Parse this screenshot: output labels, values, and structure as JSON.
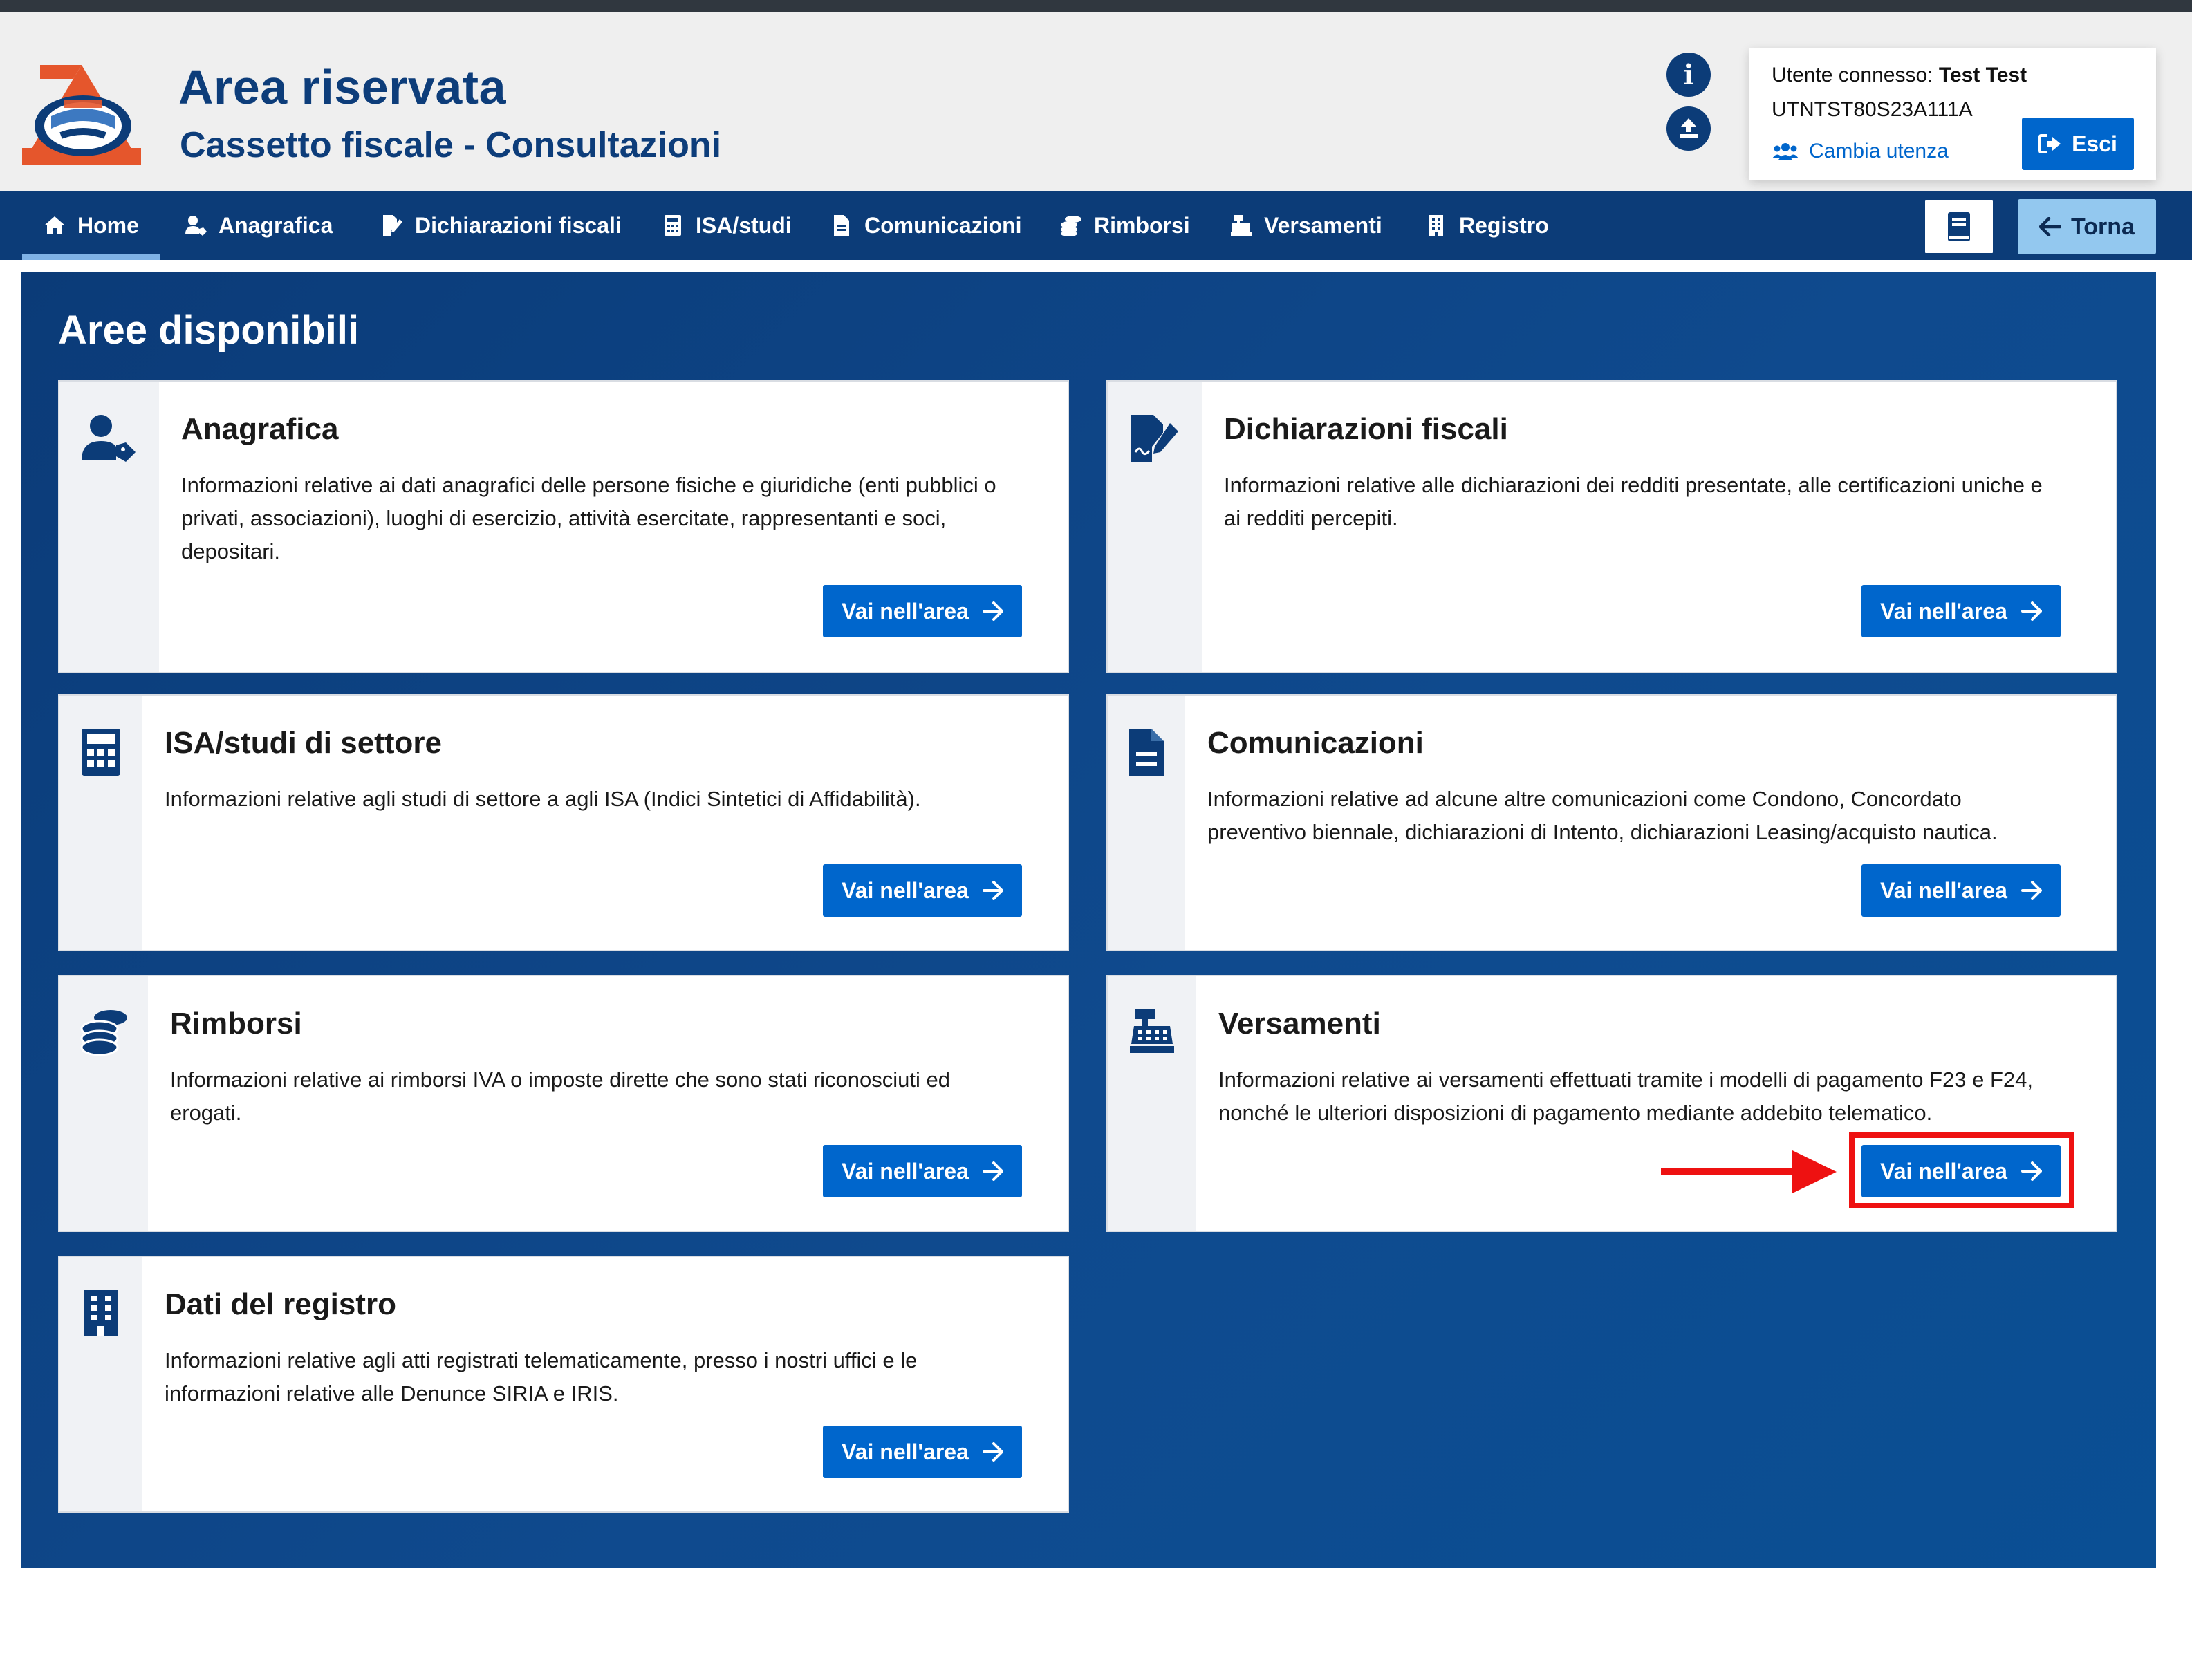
{
  "header": {
    "title": "Area riservata",
    "subtitle": "Cassetto fiscale - Consultazioni"
  },
  "user": {
    "connected_label": "Utente connesso:",
    "name": "Test Test",
    "code": "UTNTST80S23A111A",
    "change_label": "Cambia utenza",
    "logout_label": "Esci"
  },
  "nav": {
    "items": [
      {
        "label": "Home",
        "icon": "home-icon"
      },
      {
        "label": "Anagrafica",
        "icon": "user-tag-icon"
      },
      {
        "label": "Dichiarazioni fiscali",
        "icon": "file-signature-icon"
      },
      {
        "label": "ISA/studi",
        "icon": "calculator-icon"
      },
      {
        "label": "Comunicazioni",
        "icon": "file-alt-icon"
      },
      {
        "label": "Rimborsi",
        "icon": "coins-icon"
      },
      {
        "label": "Versamenti",
        "icon": "cash-register-icon"
      },
      {
        "label": "Registro",
        "icon": "building-icon"
      }
    ],
    "back_label": "Torna"
  },
  "main": {
    "title": "Aree disponibili",
    "button_label": "Vai nell'area",
    "cards": [
      {
        "title": "Anagrafica",
        "desc": [
          "Informazioni relative ai dati anagrafici delle persone fisiche e giuridiche (enti pubblici o",
          "privati, associazioni), luoghi di esercizio, attività esercitate, rappresentanti e soci,",
          "depositari."
        ],
        "icon": "user-tag-icon"
      },
      {
        "title": "Dichiarazioni fiscali",
        "desc": [
          "Informazioni relative alle dichiarazioni dei redditi presentate, alle certificazioni uniche e",
          "ai redditi percepiti."
        ],
        "icon": "file-signature-icon"
      },
      {
        "title": "ISA/studi di settore",
        "desc": [
          "Informazioni relative agli studi di settore a agli ISA (Indici Sintetici di Affidabilità)."
        ],
        "icon": "calculator-icon"
      },
      {
        "title": "Comunicazioni",
        "desc": [
          "Informazioni relative ad alcune altre comunicazioni come Condono, Concordato",
          "preventivo biennale, dichiarazioni di Intento, dichiarazioni Leasing/acquisto nautica."
        ],
        "icon": "file-alt-icon"
      },
      {
        "title": "Rimborsi",
        "desc": [
          "Informazioni relative ai rimborsi IVA o imposte dirette che sono stati riconosciuti ed",
          "erogati."
        ],
        "icon": "coins-icon"
      },
      {
        "title": "Versamenti",
        "desc": [
          "Informazioni relative ai versamenti effettuati tramite i modelli di pagamento F23 e F24,",
          "nonché le ulteriori disposizioni di pagamento mediante addebito telematico."
        ],
        "icon": "cash-register-icon"
      },
      {
        "title": "Dati del registro",
        "desc": [
          "Informazioni relative agli atti registrati telematicamente, presso i nostri uffici e le",
          "informazioni relative alle Denunce SIRIA e IRIS."
        ],
        "icon": "building-icon"
      }
    ]
  },
  "colors": {
    "brand_dark": "#0c3c78",
    "button_blue": "#0066cc",
    "highlight_red": "#ee1111",
    "logo_orange": "#e5562c"
  }
}
